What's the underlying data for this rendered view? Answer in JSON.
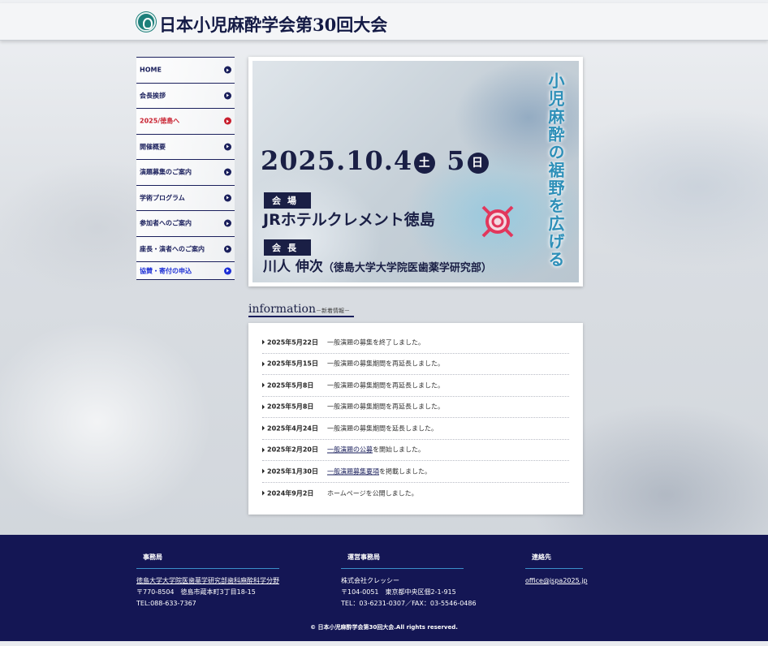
{
  "header": {
    "title": "日本小児麻酔学会第30回大会"
  },
  "sidebar": {
    "items": [
      {
        "label": "HOME"
      },
      {
        "label": "会長挨拶"
      },
      {
        "label": "2025/徳島へ"
      },
      {
        "label": "開催概要"
      },
      {
        "label": "演題募集のご案内"
      },
      {
        "label": "学術プログラム"
      },
      {
        "label": "参加者へのご案内"
      },
      {
        "label": "座長・演者へのご案内"
      },
      {
        "label": "協賛・寄付の申込"
      }
    ]
  },
  "banner": {
    "date_main": "2025.10.4",
    "day1": "土",
    "date_second": "5",
    "day2": "日",
    "venue_tag": "会場",
    "venue": "JRホテルクレメント徳島",
    "chair_tag": "会長",
    "chair_name": "川人 伸次",
    "chair_affiliation": "（徳島大学大学院医歯薬学研究部）",
    "catchphrase": "小児麻酔の裾野を広げる"
  },
  "information": {
    "title": "information",
    "subtitle": "－新着情報－",
    "items": [
      {
        "date": "2025年5月22日",
        "pre": "",
        "link": "",
        "post": "一般演題の募集を終了しました。"
      },
      {
        "date": "2025年5月15日",
        "pre": "",
        "link": "",
        "post": "一般演題の募集期間を再延長しました。"
      },
      {
        "date": "2025年5月8日",
        "pre": "",
        "link": "",
        "post": "一般演題の募集期間を再延長しました。"
      },
      {
        "date": "2025年5月8日",
        "pre": "",
        "link": "",
        "post": "一般演題の募集期間を再延長しました。"
      },
      {
        "date": "2025年4月24日",
        "pre": "",
        "link": "",
        "post": "一般演題の募集期間を延長しました。"
      },
      {
        "date": "2025年2月20日",
        "pre": "",
        "link": "一般演題の公募",
        "post": "を開始しました。"
      },
      {
        "date": "2025年1月30日",
        "pre": "",
        "link": "一般演題募集要項",
        "post": "を掲載しました。"
      },
      {
        "date": "2024年9月2日",
        "pre": "",
        "link": "",
        "post": "ホームページを公開しました。"
      }
    ]
  },
  "footer": {
    "office": {
      "heading": "事務局",
      "name": "徳島大学大学院医歯薬学研究部歯科麻酔科学分野",
      "postal": "〒770-8504　徳島市蔵本町3丁目18-15",
      "tel": "TEL:088-633-7367"
    },
    "operations": {
      "heading": "運営事務局",
      "name": "株式会社クレッシー",
      "postal": "〒104-0051　東京都中央区佃2-1-915",
      "tel": "TEL：03-6231-0307／FAX：03-5546-0486"
    },
    "contact": {
      "heading": "連絡先",
      "email": "office@jspa2025.jp"
    },
    "copyright": "© 日本小児麻酔学会第30回大会.All rights reserved."
  }
}
